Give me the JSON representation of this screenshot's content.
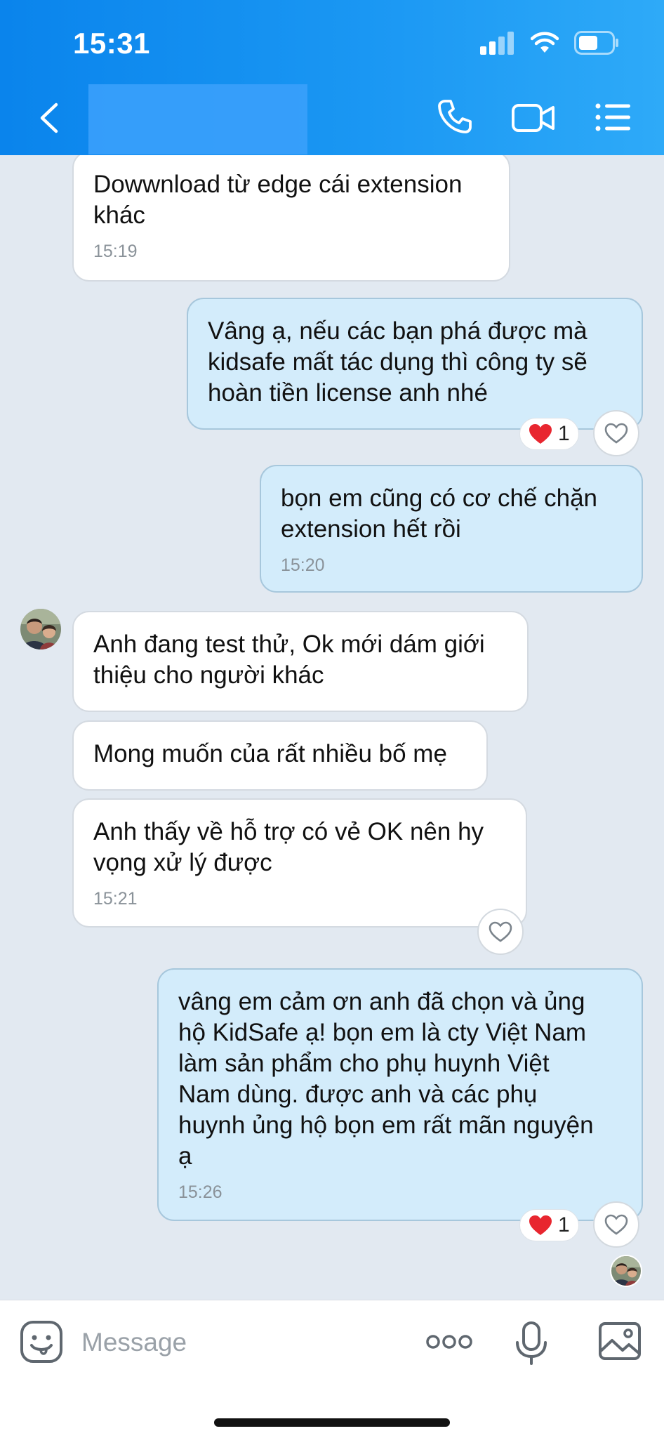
{
  "status_bar": {
    "time": "15:31"
  },
  "header": {
    "back_icon": "chevron-left-icon",
    "contact_name": "",
    "call_icon": "phone-icon",
    "video_icon": "video-camera-icon",
    "menu_icon": "list-icon"
  },
  "messages": [
    {
      "direction": "incoming",
      "text": "Dowwnload từ edge cái extension\nkhác",
      "time": "15:19"
    },
    {
      "direction": "outgoing",
      "text": "Vâng ạ, nếu các bạn phá được mà\nkidsafe mất tác dụng thì công ty sẽ\nhoàn tiền license anh nhé",
      "reaction": {
        "emoji": "heart",
        "count": "1"
      }
    },
    {
      "direction": "outgoing",
      "text": "bọn em cũng có cơ chế chặn\nextension hết rồi",
      "time": "15:20"
    },
    {
      "direction": "incoming",
      "text": "Anh đang test thử, Ok mới dám giới\nthiệu cho người khác"
    },
    {
      "direction": "incoming",
      "text": "Mong muốn của rất nhiều bố mẹ"
    },
    {
      "direction": "incoming",
      "text": "Anh thấy về hỗ trợ có vẻ OK nên hy\nvọng xử lý được",
      "time": "15:21"
    },
    {
      "direction": "outgoing",
      "text": "vâng em cảm ơn anh đã chọn và ủng\nhộ KidSafe ạ! bọn em là cty Việt Nam\nlàm sản phẩm cho phụ huynh Việt\nNam dùng. được anh và các phụ\nhuynh ủng hộ bọn em rất mãn nguyện\nạ",
      "time": "15:26",
      "reaction": {
        "emoji": "heart",
        "count": "1"
      }
    }
  ],
  "composer": {
    "placeholder": "Message",
    "sticker_icon": "sticker-face-icon",
    "more_icon": "more-dots-icon",
    "mic_icon": "microphone-icon",
    "image_icon": "image-icon"
  },
  "colors": {
    "header": "#0a84ec",
    "outgoing_bubble": "#d3ecfb",
    "incoming_bubble": "#ffffff",
    "background": "#e2e9f1",
    "heart": "#e8262f"
  }
}
